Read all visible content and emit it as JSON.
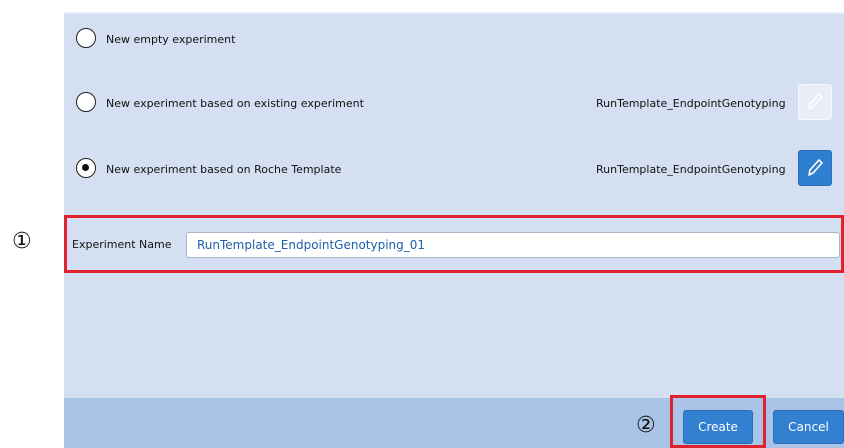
{
  "options": [
    {
      "label": "New empty experiment",
      "selected": false,
      "template": ""
    },
    {
      "label": "New experiment based on existing experiment",
      "selected": false,
      "template": "RunTemplate_EndpointGenotyping"
    },
    {
      "label": "New experiment based on Roche Template",
      "selected": true,
      "template": "RunTemplate_EndpointGenotyping"
    }
  ],
  "experiment_name": {
    "label": "Experiment Name",
    "value": "RunTemplate_EndpointGenotyping_01"
  },
  "annotations": {
    "step1": "①",
    "step2": "②"
  },
  "buttons": {
    "create": "Create",
    "cancel": "Cancel"
  },
  "colors": {
    "panel_bg": "#d4e0f1",
    "footer_bg": "#a9c4e6",
    "accent": "#3380d0",
    "highlight": "#e0222f"
  },
  "icons": {
    "edit": "pencil-icon"
  }
}
